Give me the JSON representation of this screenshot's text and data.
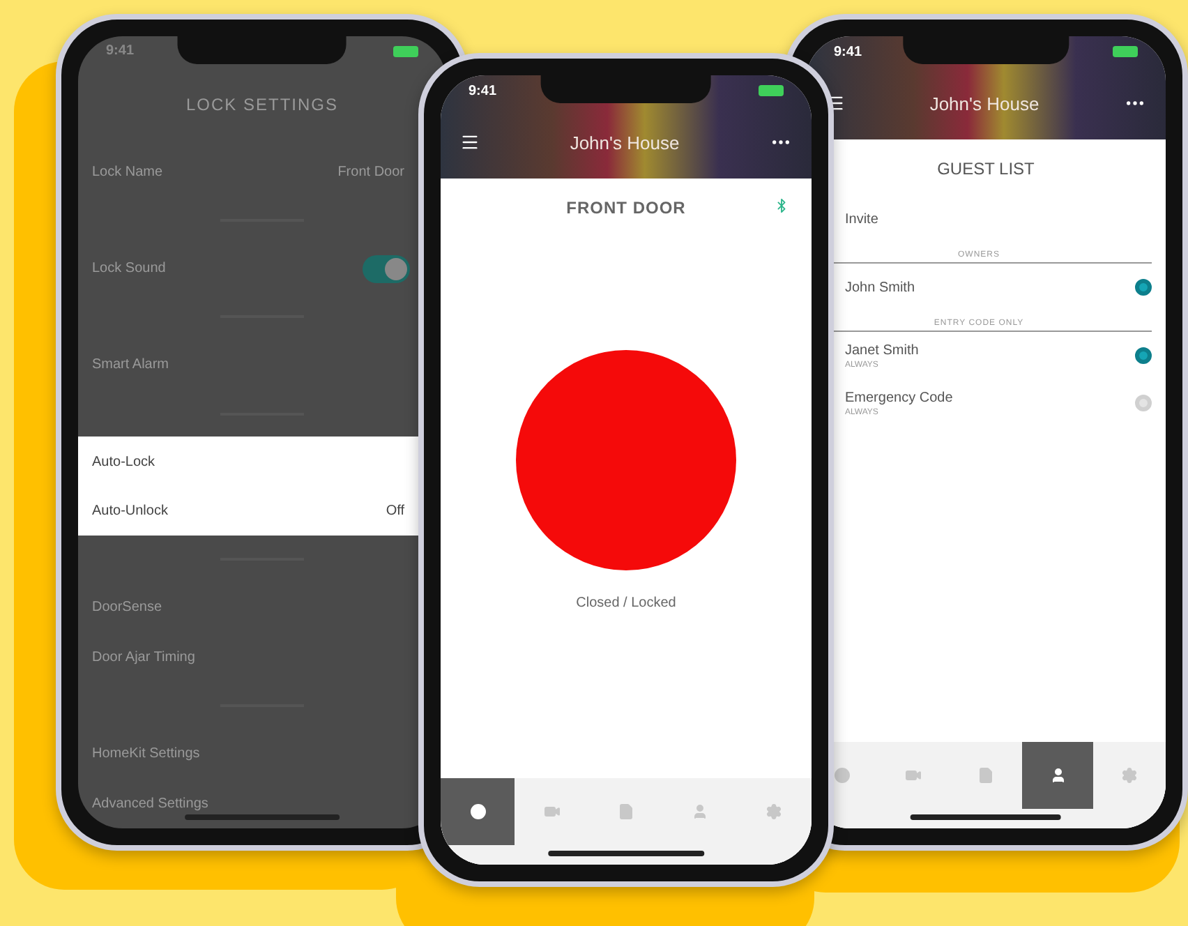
{
  "phones": [
    {
      "kind": "settings",
      "status_time": "9:41",
      "title": "LOCK SETTINGS",
      "rows": [
        {
          "kind": "row",
          "label": "Lock Name",
          "value": "Front Door",
          "highlighted": false
        },
        {
          "kind": "section"
        },
        {
          "kind": "toggle",
          "label": "Lock Sound",
          "on": true,
          "highlighted": false
        },
        {
          "kind": "section"
        },
        {
          "kind": "row",
          "label": "Smart Alarm",
          "highlighted": false
        },
        {
          "kind": "section"
        },
        {
          "kind": "row",
          "label": "Auto-Lock",
          "highlighted": true
        },
        {
          "kind": "row",
          "label": "Auto-Unlock",
          "value": "Off",
          "highlighted": true
        },
        {
          "kind": "section"
        },
        {
          "kind": "row",
          "label": "DoorSense",
          "highlighted": false
        },
        {
          "kind": "row",
          "label": "Door Ajar Timing",
          "highlighted": false
        },
        {
          "kind": "section"
        },
        {
          "kind": "row",
          "label": "HomeKit Settings",
          "highlighted": false
        },
        {
          "kind": "row",
          "label": "Advanced Settings",
          "highlighted": false
        }
      ]
    },
    {
      "kind": "lock",
      "status_time": "9:41",
      "home_title": "John's House",
      "lock_title": "FRONT DOOR",
      "locked": true,
      "status": "Closed / Locked",
      "tabs": [
        {
          "selected": true
        },
        {
          "selected": false
        },
        {
          "selected": false
        },
        {
          "selected": false
        },
        {
          "selected": false
        }
      ]
    },
    {
      "kind": "guests",
      "status_time": "9:41",
      "home_title": "John's House",
      "title": "GUEST LIST",
      "invite": "Invite",
      "groups": [
        {
          "heading": "OWNERS",
          "guests": [
            {
              "name": "John Smith",
              "active": true
            }
          ]
        },
        {
          "heading": "ENTRY CODE ONLY",
          "guests": [
            {
              "name": "Janet Smith",
              "schedule": "ALWAYS",
              "active": true
            },
            {
              "name": "Emergency Code",
              "schedule": "ALWAYS",
              "active": false
            }
          ]
        }
      ],
      "tabs": [
        {
          "selected": false
        },
        {
          "selected": false
        },
        {
          "selected": false
        },
        {
          "selected": true
        },
        {
          "selected": false
        }
      ]
    }
  ]
}
